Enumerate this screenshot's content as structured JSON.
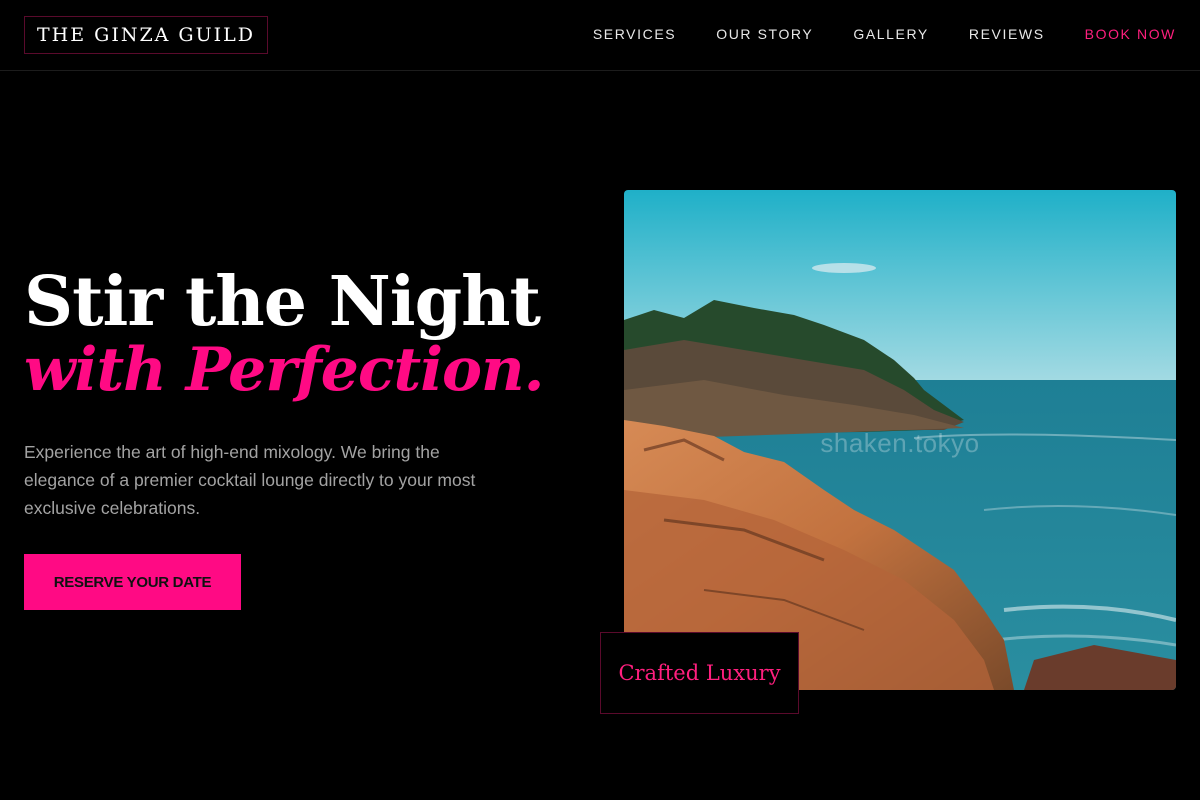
{
  "header": {
    "brand": "THE GINZA GUILD",
    "nav": [
      {
        "label": "SERVICES"
      },
      {
        "label": "OUR STORY"
      },
      {
        "label": "GALLERY"
      },
      {
        "label": "REVIEWS"
      },
      {
        "label": "BOOK NOW",
        "highlight": true
      }
    ]
  },
  "hero": {
    "title_line1": "Stir the Night",
    "title_line2": "with Perfection.",
    "description": "Experience the art of high-end mixology. We bring the elegance of a premier cocktail lounge directly to your most exclusive celebrations.",
    "cta_label": "RESERVE YOUR DATE"
  },
  "image": {
    "watermark": "shaken.tokyo",
    "subject": "coastal-cliff-photo",
    "caption": "Crafted Luxury"
  },
  "colors": {
    "background": "#000000",
    "accent": "#ff0a84",
    "muted_text": "#a3a3a3",
    "border_accent": "#5a0a2c"
  }
}
